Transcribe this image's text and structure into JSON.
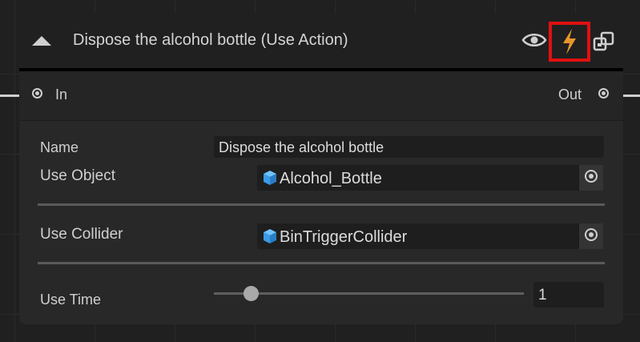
{
  "node": {
    "title": "Dispose the alcohol bottle (Use Action)",
    "header_icons": [
      "collapse-triangle-icon",
      "eye-icon",
      "lightning-bolt-icon",
      "settings-icon"
    ],
    "highlight_color": "#e01010",
    "accent_color": "#e8972a"
  },
  "ports": {
    "in_label": "In",
    "out_label": "Out"
  },
  "fields": {
    "name_label": "Name",
    "name_value": "Dispose the alcohol bottle",
    "use_object_label": "Use Object",
    "use_object_value": "Alcohol_Bottle",
    "use_collider_label": "Use Collider",
    "use_collider_value": "BinTriggerCollider",
    "use_time_label": "Use Time",
    "use_time_value": "1",
    "use_time_slider_fraction": 0.12
  }
}
